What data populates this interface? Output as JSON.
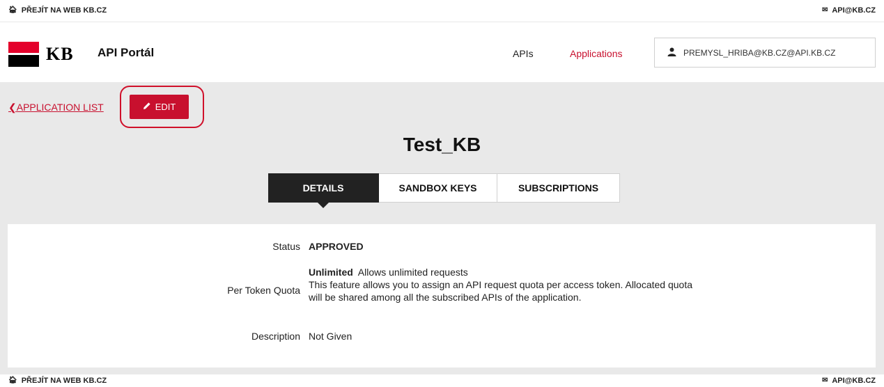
{
  "topbar": {
    "left_icon": "home-icon",
    "left_text": "PŘEJÍT NA WEB KB.CZ",
    "right_icon": "envelope-icon",
    "right_text": "API@KB.CZ"
  },
  "header": {
    "logo_text": "KB",
    "portal_title": "API Portál",
    "nav": {
      "apis": "APIs",
      "applications": "Applications"
    },
    "user": {
      "icon": "user-icon",
      "email": "PREMYSL_HRIBA@KB.CZ@API.KB.CZ"
    }
  },
  "main": {
    "back_link": "APPLICATION LIST",
    "edit_button": "EDIT",
    "app_title": "Test_KB",
    "tabs": [
      {
        "label": "DETAILS",
        "active": true
      },
      {
        "label": "SANDBOX KEYS",
        "active": false
      },
      {
        "label": "SUBSCRIPTIONS",
        "active": false
      }
    ],
    "details": {
      "status_label": "Status",
      "status_value": "APPROVED",
      "quota_label": "Per Token Quota",
      "quota_value_title": "Unlimited",
      "quota_value_desc": "Allows unlimited requests",
      "quota_help_line1": "This feature allows you to assign an API request quota per access token. Allocated quota",
      "quota_help_line2": "will be shared among all the subscribed APIs of the application.",
      "description_label": "Description",
      "description_value": "Not Given"
    }
  },
  "footer": {
    "left_text": "PŘEJÍT NA WEB KB.CZ",
    "right_text": "API@KB.CZ"
  },
  "colors": {
    "brand_red": "#c8102e",
    "logo_red": "#e4002b",
    "dark": "#222222",
    "background_gray": "#e9e9e9"
  }
}
